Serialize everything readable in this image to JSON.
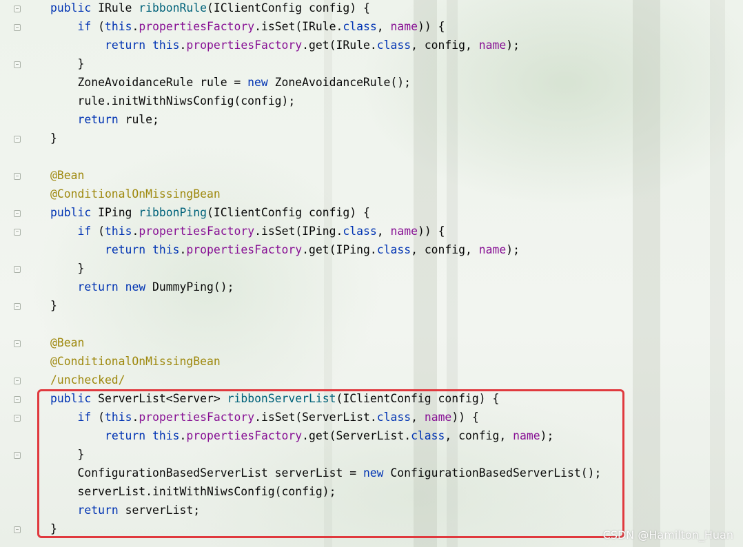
{
  "colors": {
    "keyword": "#0033b3",
    "method": "#00627a",
    "field": "#871094",
    "annotation": "#9e880d",
    "highlight_border": "#e0393e"
  },
  "code": {
    "lines": [
      [
        {
          "t": "public",
          "c": "kw"
        },
        {
          "t": " IRule "
        },
        {
          "t": "ribbonRule",
          "c": "fn"
        },
        {
          "t": "(IClientConfig config) {"
        }
      ],
      [
        {
          "t": "    "
        },
        {
          "t": "if",
          "c": "kw"
        },
        {
          "t": " ("
        },
        {
          "t": "this",
          "c": "kw"
        },
        {
          "t": "."
        },
        {
          "t": "propertiesFactory",
          "c": "fld"
        },
        {
          "t": ".isSet(IRule."
        },
        {
          "t": "class",
          "c": "kw"
        },
        {
          "t": ", "
        },
        {
          "t": "name",
          "c": "fld"
        },
        {
          "t": ")) {"
        }
      ],
      [
        {
          "t": "        "
        },
        {
          "t": "return",
          "c": "kw"
        },
        {
          "t": " "
        },
        {
          "t": "this",
          "c": "kw"
        },
        {
          "t": "."
        },
        {
          "t": "propertiesFactory",
          "c": "fld"
        },
        {
          "t": ".get(IRule."
        },
        {
          "t": "class",
          "c": "kw"
        },
        {
          "t": ", config, "
        },
        {
          "t": "name",
          "c": "fld"
        },
        {
          "t": ");"
        }
      ],
      [
        {
          "t": "    }"
        }
      ],
      [
        {
          "t": "    ZoneAvoidanceRule rule = "
        },
        {
          "t": "new",
          "c": "kw"
        },
        {
          "t": " ZoneAvoidanceRule();"
        }
      ],
      [
        {
          "t": "    rule.initWithNiwsConfig(config);"
        }
      ],
      [
        {
          "t": "    "
        },
        {
          "t": "return",
          "c": "kw"
        },
        {
          "t": " rule;"
        }
      ],
      [
        {
          "t": "}"
        }
      ],
      [],
      [
        {
          "t": "@Bean",
          "c": "ann"
        }
      ],
      [
        {
          "t": "@ConditionalOnMissingBean",
          "c": "ann"
        }
      ],
      [
        {
          "t": "public",
          "c": "kw"
        },
        {
          "t": " IPing "
        },
        {
          "t": "ribbonPing",
          "c": "fn"
        },
        {
          "t": "(IClientConfig config) {"
        }
      ],
      [
        {
          "t": "    "
        },
        {
          "t": "if",
          "c": "kw"
        },
        {
          "t": " ("
        },
        {
          "t": "this",
          "c": "kw"
        },
        {
          "t": "."
        },
        {
          "t": "propertiesFactory",
          "c": "fld"
        },
        {
          "t": ".isSet(IPing."
        },
        {
          "t": "class",
          "c": "kw"
        },
        {
          "t": ", "
        },
        {
          "t": "name",
          "c": "fld"
        },
        {
          "t": ")) {"
        }
      ],
      [
        {
          "t": "        "
        },
        {
          "t": "return",
          "c": "kw"
        },
        {
          "t": " "
        },
        {
          "t": "this",
          "c": "kw"
        },
        {
          "t": "."
        },
        {
          "t": "propertiesFactory",
          "c": "fld"
        },
        {
          "t": ".get(IPing."
        },
        {
          "t": "class",
          "c": "kw"
        },
        {
          "t": ", config, "
        },
        {
          "t": "name",
          "c": "fld"
        },
        {
          "t": ");"
        }
      ],
      [
        {
          "t": "    }"
        }
      ],
      [
        {
          "t": "    "
        },
        {
          "t": "return",
          "c": "kw"
        },
        {
          "t": " "
        },
        {
          "t": "new",
          "c": "kw"
        },
        {
          "t": " DummyPing();"
        }
      ],
      [
        {
          "t": "}"
        }
      ],
      [],
      [
        {
          "t": "@Bean",
          "c": "ann"
        }
      ],
      [
        {
          "t": "@ConditionalOnMissingBean",
          "c": "ann"
        }
      ],
      [
        {
          "t": "/unchecked/",
          "c": "ann"
        }
      ],
      [
        {
          "t": "public",
          "c": "kw"
        },
        {
          "t": " ServerList<Server> "
        },
        {
          "t": "ribbonServerList",
          "c": "fn"
        },
        {
          "t": "(IClientConfig config) {"
        }
      ],
      [
        {
          "t": "    "
        },
        {
          "t": "if",
          "c": "kw"
        },
        {
          "t": " ("
        },
        {
          "t": "this",
          "c": "kw"
        },
        {
          "t": "."
        },
        {
          "t": "propertiesFactory",
          "c": "fld"
        },
        {
          "t": ".isSet(ServerList."
        },
        {
          "t": "class",
          "c": "kw"
        },
        {
          "t": ", "
        },
        {
          "t": "name",
          "c": "fld"
        },
        {
          "t": ")) {"
        }
      ],
      [
        {
          "t": "        "
        },
        {
          "t": "return",
          "c": "kw"
        },
        {
          "t": " "
        },
        {
          "t": "this",
          "c": "kw"
        },
        {
          "t": "."
        },
        {
          "t": "propertiesFactory",
          "c": "fld"
        },
        {
          "t": ".get(ServerList."
        },
        {
          "t": "class",
          "c": "kw"
        },
        {
          "t": ", config, "
        },
        {
          "t": "name",
          "c": "fld"
        },
        {
          "t": ");"
        }
      ],
      [
        {
          "t": "    }"
        }
      ],
      [
        {
          "t": "    ConfigurationBasedServerList serverList = "
        },
        {
          "t": "new",
          "c": "kw"
        },
        {
          "t": " ConfigurationBasedServerList();"
        }
      ],
      [
        {
          "t": "    serverList.initWithNiwsConfig(config);"
        }
      ],
      [
        {
          "t": "    "
        },
        {
          "t": "return",
          "c": "kw"
        },
        {
          "t": " serverList;"
        }
      ],
      [
        {
          "t": "}"
        }
      ]
    ]
  },
  "watermark": "CSDN @Hamilton_Huan"
}
